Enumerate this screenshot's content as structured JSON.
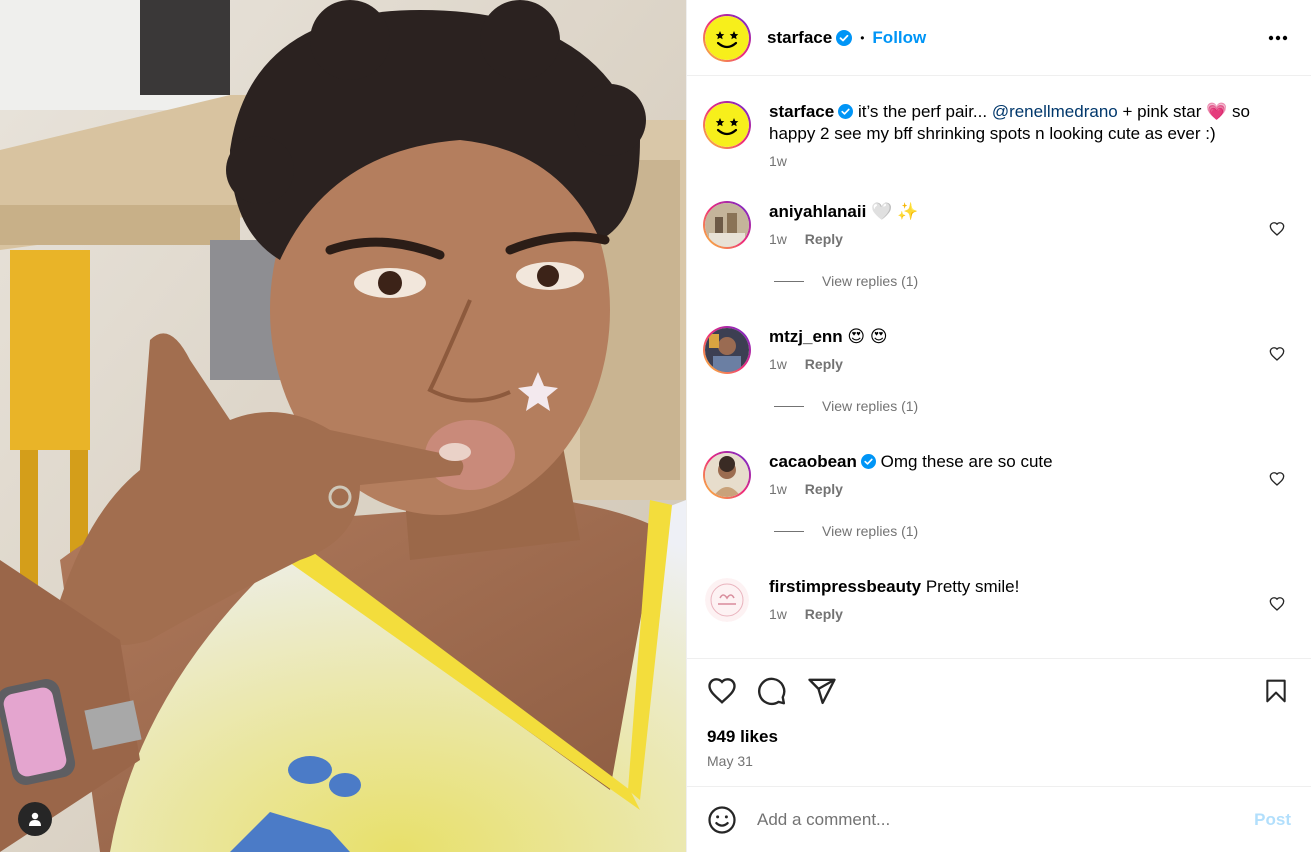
{
  "post": {
    "author": "starface",
    "follow_label": "Follow",
    "separator": "•",
    "likes": "949 likes",
    "date": "May 31"
  },
  "caption": {
    "username": "starface",
    "text_before": " it’s the perf pair... ",
    "mention": "@renellmedrano",
    "text_middle": " + pink star ",
    "emoji": "💗",
    "text_after": " so happy 2 see my bff shrinking spots n looking cute as ever :)",
    "time": "1w"
  },
  "comments": [
    {
      "username": "aniyahlanaii",
      "verified": false,
      "text": " 🤍 ✨",
      "time": "1w",
      "reply_label": "Reply",
      "view_replies": "View replies (1)"
    },
    {
      "username": "mtzj_enn",
      "verified": false,
      "text": " 😍 😍",
      "time": "1w",
      "reply_label": "Reply",
      "view_replies": "View replies (1)"
    },
    {
      "username": "cacaobean",
      "verified": true,
      "text": " Omg these are so cute",
      "time": "1w",
      "reply_label": "Reply",
      "view_replies": "View replies (1)"
    },
    {
      "username": "firstimpressbeauty",
      "verified": false,
      "text": " Pretty smile!",
      "time": "1w",
      "reply_label": "Reply"
    }
  ],
  "comment_input": {
    "placeholder": "Add a comment...",
    "post_label": "Post"
  },
  "icons": {
    "verified": "verified-badge-icon",
    "more": "more-options-icon",
    "like": "heart-icon",
    "comment": "comment-icon",
    "share": "share-icon",
    "save": "bookmark-icon",
    "emoji": "emoji-icon",
    "tag": "user-tag-icon"
  },
  "colors": {
    "accent": "#0095f6",
    "brand_yellow": "#f7ef1b",
    "secondary_text": "#737373",
    "post_disabled": "#b2dffc"
  }
}
